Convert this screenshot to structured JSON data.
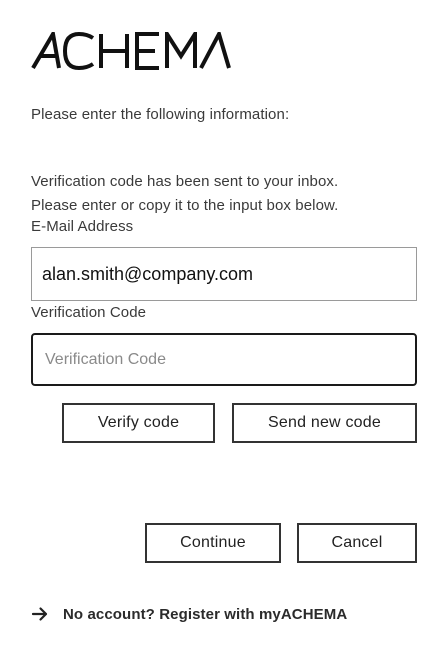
{
  "brand": {
    "logo_text": "ACHEMA"
  },
  "form": {
    "intro": "Please enter the following information:",
    "notice_line1": "Verification code has been sent to your inbox.",
    "notice_line2": "Please enter or copy it to the input box below.",
    "email_label": "E-Mail Address",
    "email_value": "alan.smith@company.com",
    "code_label": "Verification Code",
    "code_placeholder": "Verification Code",
    "code_value": ""
  },
  "buttons": {
    "verify": "Verify code",
    "resend": "Send new code",
    "continue": "Continue",
    "cancel": "Cancel"
  },
  "footer": {
    "register_link": "No account? Register with myACHEMA",
    "register_icon": "arrow-right-icon"
  },
  "colors": {
    "text": "#2b2b2b",
    "border": "#333333",
    "background": "#ffffff"
  }
}
